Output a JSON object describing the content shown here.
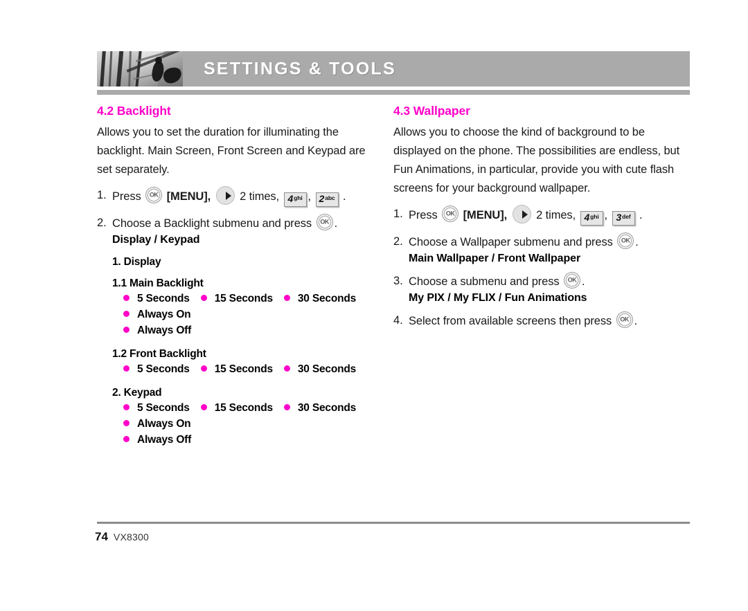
{
  "header": {
    "title": "SETTINGS & TOOLS",
    "photo_alt": "grayscale-architecture-photo",
    "bar_color": "#aaaaaa"
  },
  "theme": {
    "accent": "#ff00c8",
    "text": "#1a1a1a",
    "rule": "#8c8c8c"
  },
  "left_column": {
    "section": {
      "number": "4.2",
      "title": "4.2 Backlight"
    },
    "intro": "Allows you to set the duration for illuminating the backlight. Main Screen, Front Screen and Keypad are set separately.",
    "steps": [
      {
        "num": "1.",
        "pre": "Press",
        "menu_label": "[MENU],",
        "times": "2 times,",
        "key1": {
          "digit": "4",
          "letters": "ghi"
        },
        "sep": ",",
        "key2": {
          "digit": "2",
          "letters": "abc"
        },
        "end": "."
      },
      {
        "num": "2.",
        "pre": "Choose a Backlight submenu and press",
        "end": "."
      }
    ],
    "submenu_label": "Display / Keypad",
    "groups": [
      {
        "heading": "1. Display",
        "subgroups": [
          {
            "heading": "1.1 Main Backlight",
            "rows": [
              [
                "5 Seconds",
                "15 Seconds",
                "30 Seconds"
              ],
              [
                "Always On"
              ],
              [
                "Always Off"
              ]
            ]
          },
          {
            "heading": "1.2 Front Backlight",
            "rows": [
              [
                "5 Seconds",
                "15 Seconds",
                "30 Seconds"
              ]
            ]
          }
        ]
      },
      {
        "heading": "2. Keypad",
        "rows": [
          [
            "5 Seconds",
            "15 Seconds",
            "30 Seconds"
          ],
          [
            "Always On"
          ],
          [
            "Always Off"
          ]
        ]
      }
    ]
  },
  "right_column": {
    "section": {
      "number": "4.3",
      "title": "4.3 Wallpaper"
    },
    "intro": "Allows you to choose the kind of background to be displayed on the phone. The possibilities are endless, but Fun Animations, in particular, provide you with cute flash screens for your background wallpaper.",
    "steps": [
      {
        "num": "1.",
        "pre": "Press",
        "menu_label": "[MENU],",
        "times": "2 times,",
        "key1": {
          "digit": "4",
          "letters": "ghi"
        },
        "sep": ",",
        "key2": {
          "digit": "3",
          "letters": "def"
        },
        "end": "."
      },
      {
        "num": "2.",
        "pre": "Choose a Wallpaper submenu and press",
        "end": ".",
        "sub_label": "Main Wallpaper / Front Wallpaper"
      },
      {
        "num": "3.",
        "pre": "Choose a submenu and press",
        "end": ".",
        "sub_label": "My PIX / My FLIX / Fun Animations"
      },
      {
        "num": "4.",
        "pre": "Select from available screens then press",
        "end": "."
      }
    ]
  },
  "footer": {
    "page_number": "74",
    "model": "VX8300"
  }
}
